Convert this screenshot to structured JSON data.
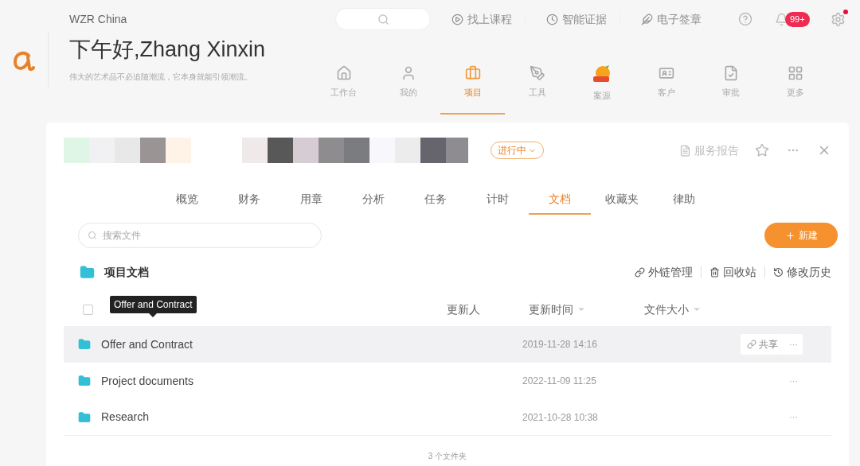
{
  "header": {
    "org": "WZR China",
    "greeting": "下午好,Zhang Xinxin",
    "motto": "伟大的艺术品不必追随潮流，它本身就能引领潮流。"
  },
  "top_links": [
    {
      "label": "找上课程"
    },
    {
      "label": "智能证据"
    },
    {
      "label": "电子签章"
    }
  ],
  "notifications": {
    "badge": "99+"
  },
  "settings": {
    "alert": true
  },
  "nav": [
    {
      "label": "工作台",
      "selected": false
    },
    {
      "label": "我的",
      "selected": false
    },
    {
      "label": "项目",
      "selected": true
    },
    {
      "label": "工具",
      "selected": false
    },
    {
      "label": "案源",
      "selected": false
    },
    {
      "label": "客户",
      "selected": false
    },
    {
      "label": "审批",
      "selected": false
    },
    {
      "label": "更多",
      "selected": false
    }
  ],
  "project": {
    "status": "进行中",
    "actions": [
      {
        "label": "服务报告"
      }
    ]
  },
  "tabs": [
    {
      "label": "概览",
      "selected": false
    },
    {
      "label": "财务",
      "selected": false
    },
    {
      "label": "用章",
      "selected": false
    },
    {
      "label": "分析",
      "selected": false
    },
    {
      "label": "任务",
      "selected": false
    },
    {
      "label": "计时",
      "selected": false
    },
    {
      "label": "文档",
      "selected": true
    },
    {
      "label": "收藏夹",
      "selected": false
    },
    {
      "label": "律助",
      "selected": false
    }
  ],
  "search": {
    "placeholder": "搜索文件"
  },
  "new_button": "新建",
  "folder_title": "项目文档",
  "toolbar": [
    {
      "label": "外链管理"
    },
    {
      "label": "回收站"
    },
    {
      "label": "修改历史"
    }
  ],
  "table": {
    "select_all": {
      "checked": false
    },
    "columns": [
      {
        "label": "更新人",
        "sortable": false
      },
      {
        "label": "更新时间",
        "sortable": true
      },
      {
        "label": "文件大小",
        "sortable": true
      }
    ],
    "rows": [
      {
        "name": "Offer and Contract",
        "time": "2019-11-28 14:16",
        "hovered": true,
        "share": "共享",
        "more": "···"
      },
      {
        "name": "Project documents",
        "time": "2022-11-09 11:25",
        "hovered": false,
        "more": "···"
      },
      {
        "name": "Research",
        "time": "2021-10-28 10:38",
        "hovered": false,
        "more": "···"
      }
    ],
    "tooltip": "Offer and Contract",
    "footer": "3 个文件夹"
  }
}
